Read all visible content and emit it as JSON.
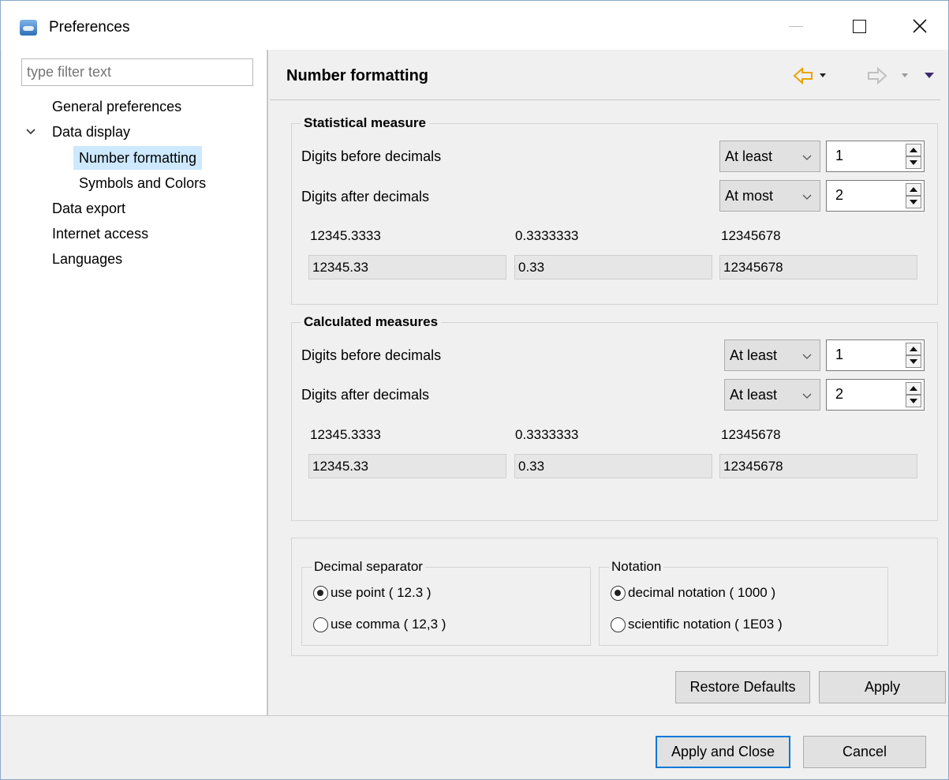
{
  "window": {
    "title": "Preferences"
  },
  "filter": {
    "placeholder": "type filter text"
  },
  "tree": {
    "items": [
      {
        "label": "General preferences"
      },
      {
        "label": "Data display"
      },
      {
        "label": "Number formatting"
      },
      {
        "label": "Symbols and Colors"
      },
      {
        "label": "Data export"
      },
      {
        "label": "Internet access"
      },
      {
        "label": "Languages"
      }
    ]
  },
  "page": {
    "title": "Number formatting"
  },
  "statistical": {
    "label": "Statistical measure",
    "before_label": "Digits before decimals",
    "before_mode": "At least",
    "before_value": "1",
    "after_label": "Digits after decimals",
    "after_mode": "At most",
    "after_value": "2",
    "samples": [
      {
        "input": "12345.3333",
        "output": "12345.33"
      },
      {
        "input": "0.3333333",
        "output": "0.33"
      },
      {
        "input": "12345678",
        "output": "12345678"
      }
    ]
  },
  "calculated": {
    "label": "Calculated measures",
    "before_label": "Digits before decimals",
    "before_mode": "At least",
    "before_value": "1",
    "after_label": "Digits after decimals",
    "after_mode": "At least",
    "after_value": "2",
    "samples": [
      {
        "input": "12345.3333",
        "output": "12345.33"
      },
      {
        "input": "0.3333333",
        "output": "0.33"
      },
      {
        "input": "12345678",
        "output": "12345678"
      }
    ]
  },
  "decimal_separator": {
    "label": "Decimal separator",
    "options": [
      {
        "label": "use point ( 12.3 )",
        "checked": true
      },
      {
        "label": "use comma ( 12,3 )",
        "checked": false
      }
    ]
  },
  "notation": {
    "label": "Notation",
    "options": [
      {
        "label": "decimal notation ( 1000 )",
        "checked": true
      },
      {
        "label": "scientific notation ( 1E03 )",
        "checked": false
      }
    ]
  },
  "buttons": {
    "restore_defaults": "Restore Defaults",
    "apply": "Apply",
    "apply_close": "Apply and Close",
    "cancel": "Cancel"
  },
  "colors": {
    "selection": "#cde8ff",
    "accent": "#0078d7",
    "back_arrow": "#e8a400"
  }
}
